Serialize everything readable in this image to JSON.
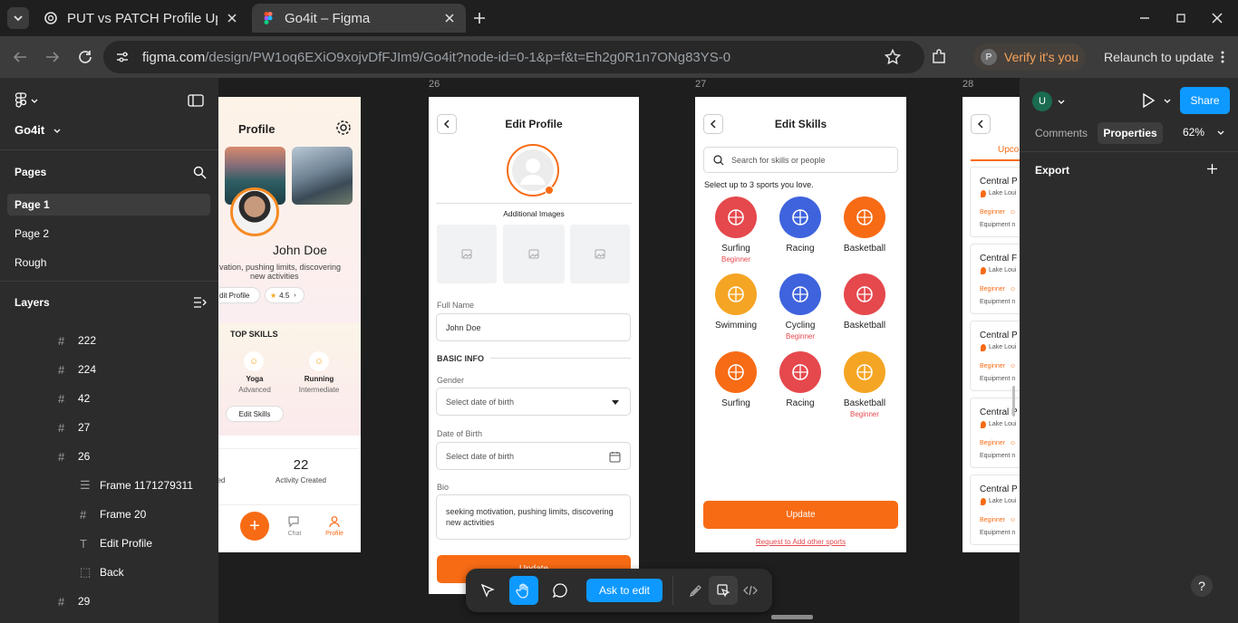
{
  "browser": {
    "tabs": [
      {
        "title": "PUT vs PATCH Profile Upd",
        "active": false
      },
      {
        "title": "Go4it – Figma",
        "active": true
      }
    ],
    "url_host": "figma.com",
    "url_path": "/design/PW1oq6EXiO9xojvDfFJIm9/Go4it?node-id=0-1&p=f&t=Eh2g0R1n7ONg83YS-0",
    "profile_initial": "P",
    "verify_label": "Verify it's you",
    "relaunch_label": "Relaunch to update"
  },
  "left_panel": {
    "file_name": "Go4it",
    "pages_title": "Pages",
    "pages": [
      "Page 1",
      "Page 2",
      "Rough"
    ],
    "layers_title": "Layers",
    "layers": [
      {
        "name": "222",
        "icon": "frame-icon",
        "indent": 0
      },
      {
        "name": "224",
        "icon": "frame-icon",
        "indent": 0
      },
      {
        "name": "42",
        "icon": "frame-icon",
        "indent": 0
      },
      {
        "name": "27",
        "icon": "frame-icon",
        "indent": 0
      },
      {
        "name": "26",
        "icon": "frame-icon",
        "indent": 0
      },
      {
        "name": "Frame 1171279311",
        "icon": "autolayout-icon",
        "indent": 1
      },
      {
        "name": "Frame 20",
        "icon": "frame-icon",
        "indent": 1
      },
      {
        "name": "Edit Profile",
        "icon": "text-icon",
        "indent": 1
      },
      {
        "name": "Back",
        "icon": "dashed-frame-icon",
        "indent": 1
      },
      {
        "name": "29",
        "icon": "frame-icon",
        "indent": 0
      }
    ]
  },
  "right_panel": {
    "avatar_initial": "U",
    "share_label": "Share",
    "tabs": [
      "Comments",
      "Properties"
    ],
    "zoom": "62%",
    "export_label": "Export",
    "help_label": "?"
  },
  "toolbar": {
    "ask_to_edit": "Ask to edit"
  },
  "canvas": {
    "frame_labels": [
      "26",
      "27",
      "28"
    ],
    "profile": {
      "title": "Profile",
      "name": "John Doe",
      "bio_line1": "vation, pushing limits, discovering",
      "bio_line2": "new activities",
      "edit_profile": "dit Profile",
      "rating": "4.5",
      "top_skills": "TOP SKILLS",
      "skills": [
        {
          "name": "Yoga",
          "level": "Advanced"
        },
        {
          "name": "Running",
          "level": "Intermediate"
        }
      ],
      "edit_skills": "Edit Skills",
      "stat_left": "ned",
      "stat_value": "22",
      "stat_label": "Activity Created",
      "nav": [
        "ery",
        "Chat",
        "Profile"
      ]
    },
    "edit_profile": {
      "title": "Edit Profile",
      "additional_images": "Additional Images",
      "full_name_label": "Full Name",
      "full_name_value": "John Doe",
      "basic_info": "BASIC INFO",
      "gender_label": "Gender",
      "gender_value": "Select date of birth",
      "dob_label": "Date of Birth",
      "dob_value": "Select date of birth",
      "bio_label": "Bio",
      "bio_value": "seeking motivation, pushing limits, discovering new activities",
      "update": "Update"
    },
    "edit_skills": {
      "title": "Edit Skills",
      "search_placeholder": "Search for skills or people",
      "hint": "Select up to 3 sports you love.",
      "sports": [
        {
          "name": "Surfing",
          "level": "Beginner",
          "color": "#e5484d"
        },
        {
          "name": "Racing",
          "level": "",
          "color": "#3e63dd"
        },
        {
          "name": "Basketball",
          "level": "",
          "color": "#f76b15"
        },
        {
          "name": "Swimming",
          "level": "",
          "color": "#f5a524"
        },
        {
          "name": "Cycling",
          "level": "Beginner",
          "color": "#3e63dd"
        },
        {
          "name": "Basketball",
          "level": "",
          "color": "#e5484d"
        },
        {
          "name": "Surfing",
          "level": "",
          "color": "#f76b15"
        },
        {
          "name": "Racing",
          "level": "",
          "color": "#e5484d"
        },
        {
          "name": "Basketball",
          "level": "Beginner",
          "color": "#f5a524"
        }
      ],
      "update": "Update",
      "request_link": "Request to Add other sports"
    },
    "events": {
      "tab": "Upco",
      "cards": [
        {
          "title": "Central P",
          "location": "Lake Loui",
          "level": "Beginner",
          "meta": "Equipment n"
        },
        {
          "title": "Central F",
          "location": "Lake Loui",
          "level": "Beginner",
          "meta": "Equipment n"
        },
        {
          "title": "Central P",
          "location": "Lake Loui",
          "level": "Beginner",
          "meta": "Equipment n"
        },
        {
          "title": "Central P",
          "location": "Lake Loui",
          "level": "Beginner",
          "meta": "Equipment n"
        },
        {
          "title": "Central P",
          "location": "Lake Loui",
          "level": "Beginner",
          "meta": "Equipment n"
        }
      ]
    }
  }
}
